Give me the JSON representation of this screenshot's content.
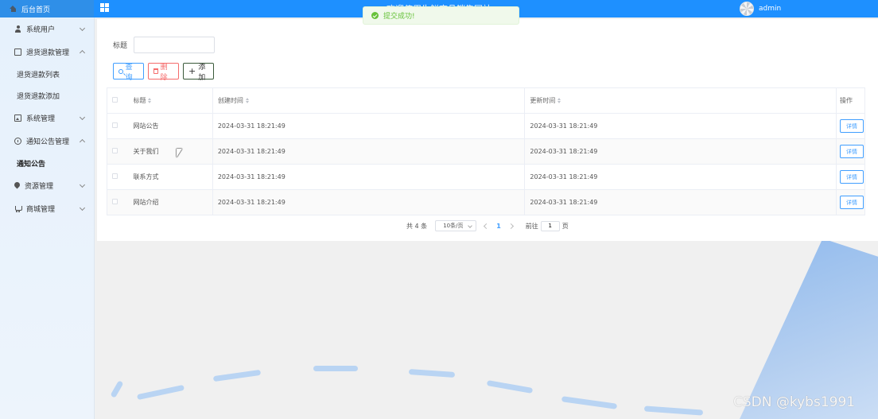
{
  "header": {
    "home_label": "后台首页",
    "site_title": "欢迎使用生鲜商品销售网站",
    "username": "admin"
  },
  "toast": {
    "message": "提交成功!"
  },
  "sidebar": {
    "items": [
      {
        "label": "系统用户",
        "icon": "user-icon",
        "expanded": false
      },
      {
        "label": "退货退款管理",
        "icon": "edit-icon",
        "expanded": true,
        "children": [
          {
            "label": "退货退款列表"
          },
          {
            "label": "退货退款添加"
          }
        ]
      },
      {
        "label": "系统管理",
        "icon": "image-icon",
        "expanded": false
      },
      {
        "label": "通知公告管理",
        "icon": "info-icon",
        "expanded": true,
        "children": [
          {
            "label": "通知公告",
            "active": true
          }
        ]
      },
      {
        "label": "资源管理",
        "icon": "location-icon",
        "expanded": false
      },
      {
        "label": "商城管理",
        "icon": "cart-icon",
        "expanded": false
      }
    ]
  },
  "search": {
    "label": "标题",
    "value": "",
    "placeholder": ""
  },
  "buttons": {
    "query": "查询",
    "delete": "删除",
    "add": "添加"
  },
  "table": {
    "columns": [
      "标题",
      "创建时间",
      "更新时间",
      "操作"
    ],
    "action_label": "详情",
    "rows": [
      {
        "title": "网站公告",
        "created": "2024-03-31 18:21:49",
        "updated": "2024-03-31 18:21:49"
      },
      {
        "title": "关于我们",
        "created": "2024-03-31 18:21:49",
        "updated": "2024-03-31 18:21:49"
      },
      {
        "title": "联系方式",
        "created": "2024-03-31 18:21:49",
        "updated": "2024-03-31 18:21:49"
      },
      {
        "title": "网站介绍",
        "created": "2024-03-31 18:21:49",
        "updated": "2024-03-31 18:21:49"
      }
    ]
  },
  "pagination": {
    "total_text": "共 4 条",
    "page_size": "10条/页",
    "current_page": "1",
    "goto_prefix": "前往",
    "goto_value": "1",
    "goto_suffix": "页"
  },
  "watermark": "CSDN @kybs1991",
  "colors": {
    "primary": "#409eff",
    "danger": "#f56c6c",
    "success": "#67c23a",
    "topbar": "#1e90ff"
  }
}
